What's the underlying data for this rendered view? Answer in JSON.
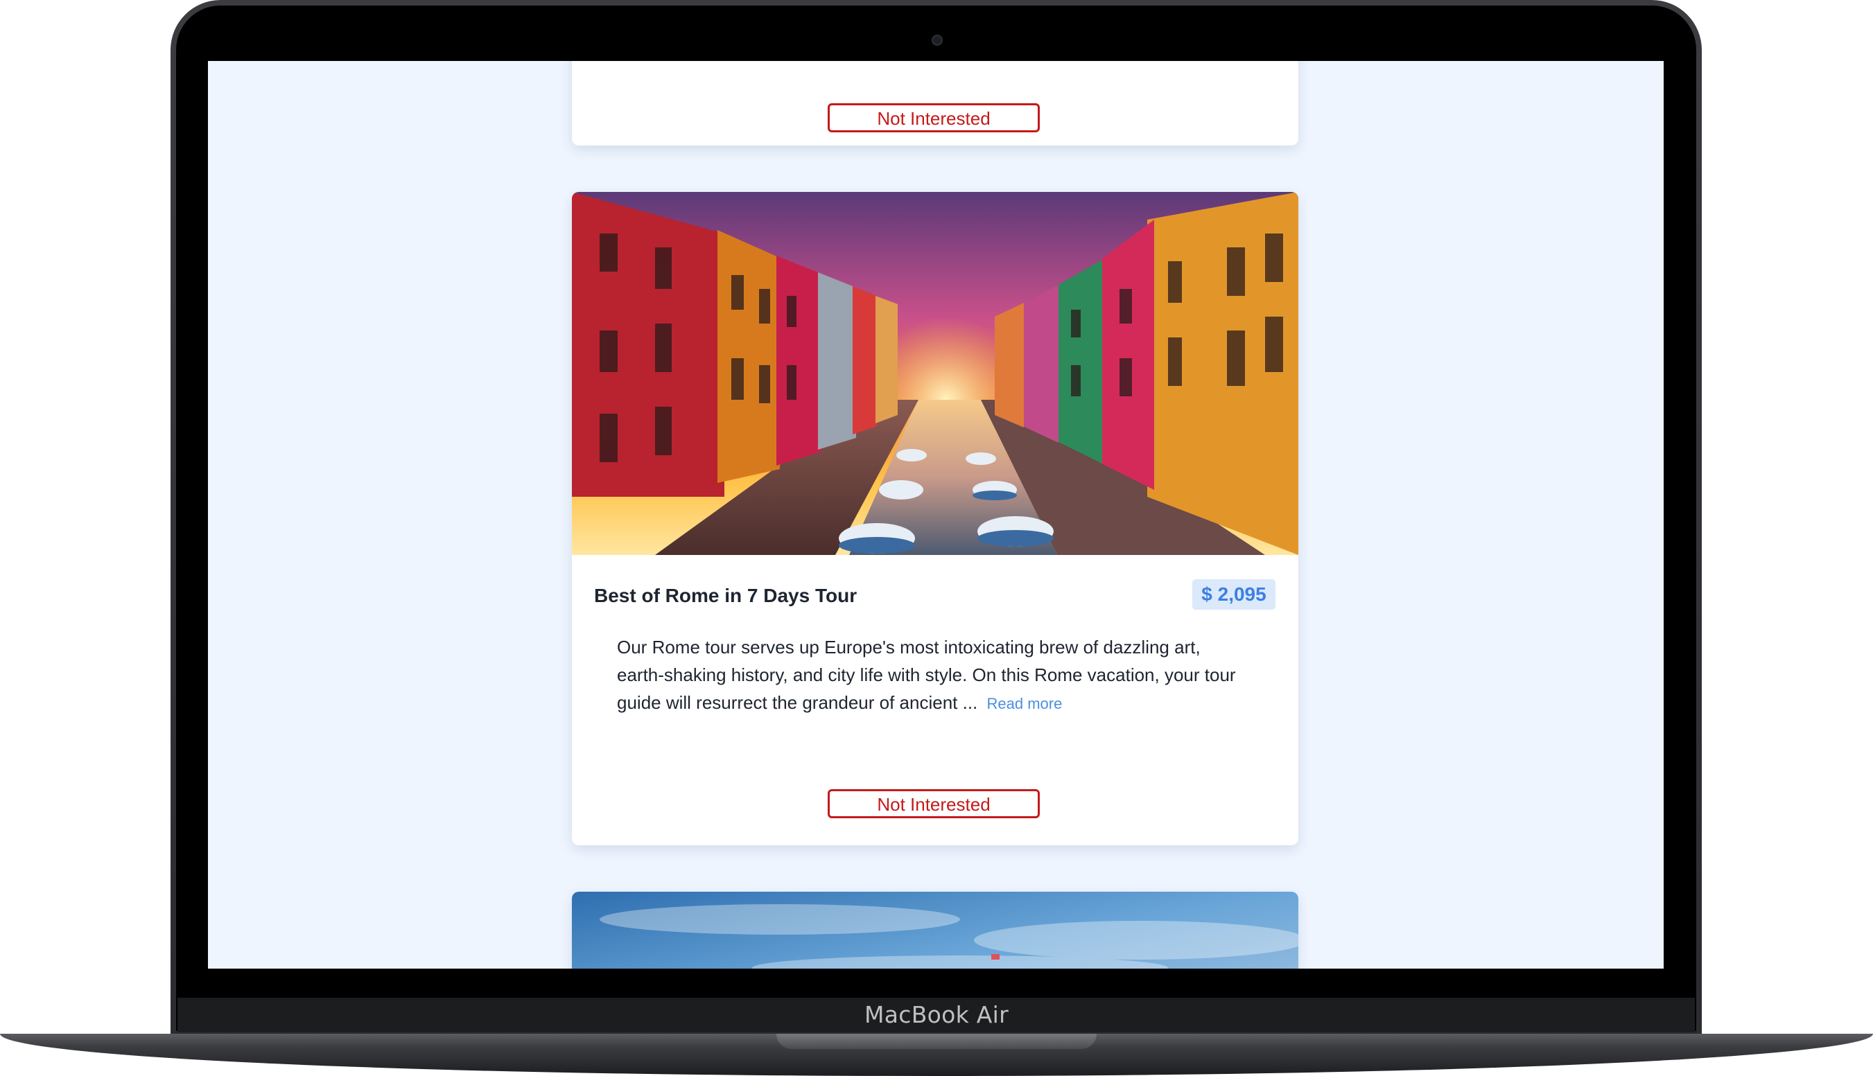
{
  "device": {
    "label": "MacBook Air"
  },
  "tours": {
    "previous_card": {
      "not_interested_label": "Not Interested"
    },
    "featured": {
      "title": "Best of Rome in 7 Days Tour",
      "price": "$ 2,095",
      "description": "Our Rome tour serves up Europe's most intoxicating brew of dazzling art, earth-shaking history, and city life with style. On this Rome vacation, your tour guide will resurrect the grandeur of ancient ...",
      "read_more_label": "Read more",
      "not_interested_label": "Not Interested",
      "image_icon": "venice-canal-sunset-photo"
    },
    "next_card": {
      "image_icon": "sky-photo"
    }
  },
  "colors": {
    "page_background": "#eef5ff",
    "card_background": "#ffffff",
    "danger": "#c41a1a",
    "price_text": "#3d7fe0",
    "price_background": "#dbe9fb",
    "link": "#4b8fe0"
  }
}
